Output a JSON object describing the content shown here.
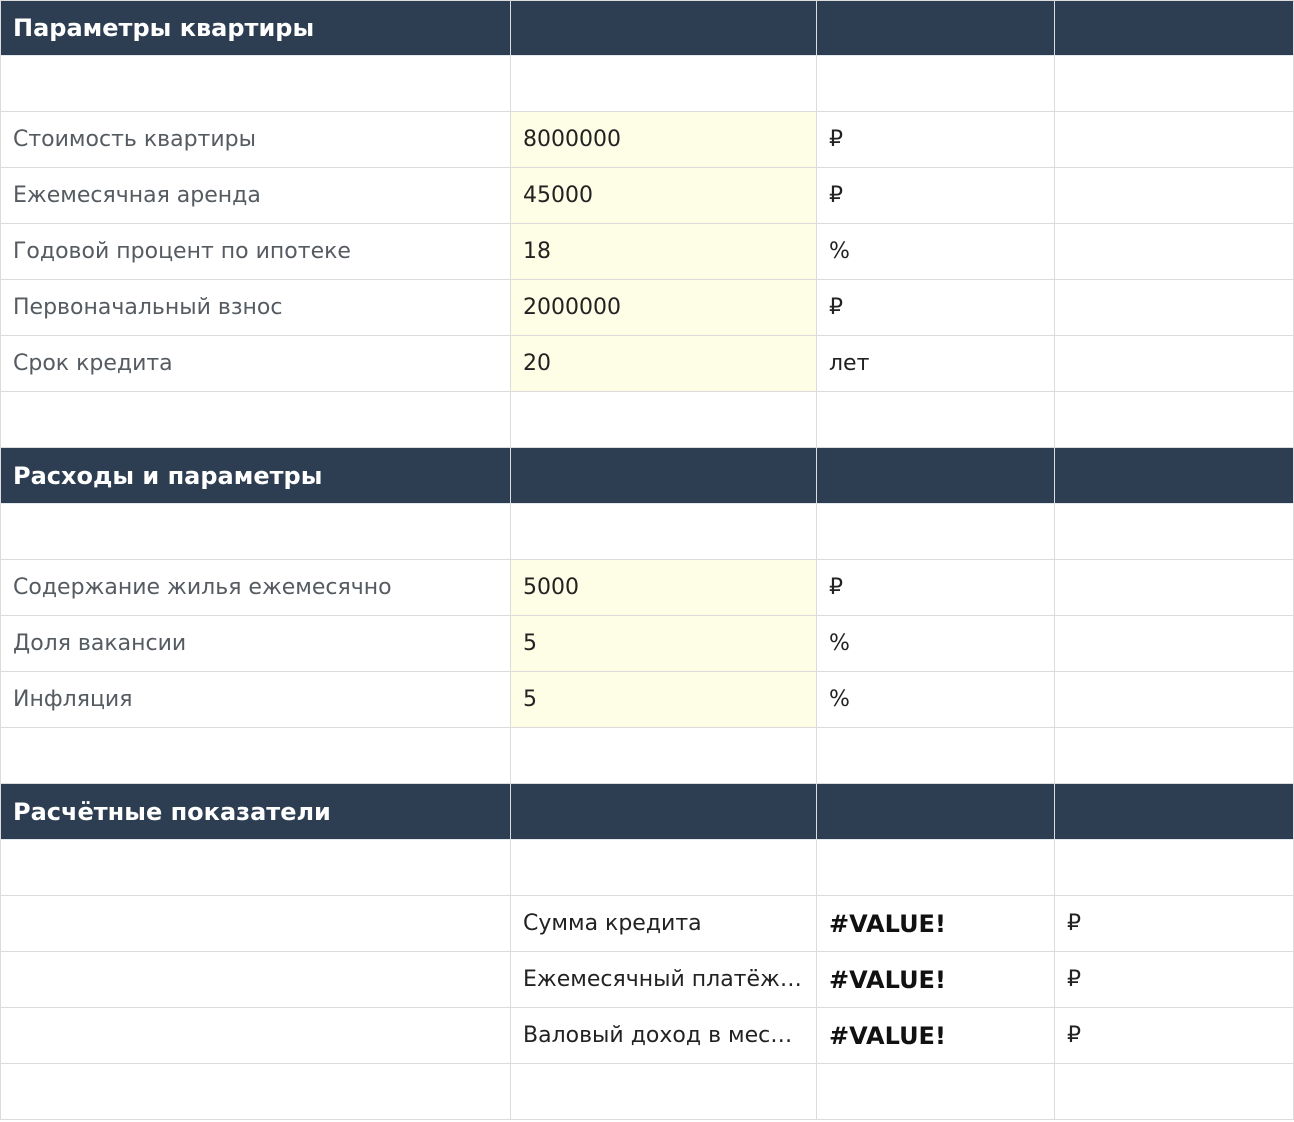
{
  "sections": {
    "apartment": {
      "title": "Параметры квартиры",
      "rows": [
        {
          "label": "Стоимость квартиры",
          "value": "8000000",
          "unit": "₽"
        },
        {
          "label": "Ежемесячная аренда",
          "value": "45000",
          "unit": "₽"
        },
        {
          "label": "Годовой процент по ипотеке",
          "value": "18",
          "unit": "%"
        },
        {
          "label": "Первоначальный взнос",
          "value": "2000000",
          "unit": "₽"
        },
        {
          "label": "Срок кредита",
          "value": "20",
          "unit": "лет"
        }
      ]
    },
    "expenses": {
      "title": "Расходы и параметры",
      "rows": [
        {
          "label": "Содержание жилья ежемесячно",
          "value": "5000",
          "unit": "₽"
        },
        {
          "label": "Доля вакансии",
          "value": "5",
          "unit": "%"
        },
        {
          "label": "Инфляция",
          "value": "5",
          "unit": "%"
        }
      ]
    },
    "calculated": {
      "title": "Расчётные показатели",
      "rows": [
        {
          "label": "Сумма кредита",
          "value": "#VALUE!",
          "unit": "₽"
        },
        {
          "label": "Ежемесячный платёж…",
          "value": "#VALUE!",
          "unit": "₽"
        },
        {
          "label": "Валовый доход в мес…",
          "value": "#VALUE!",
          "unit": "₽"
        }
      ]
    }
  },
  "colors": {
    "header_bg": "#2e3e52",
    "input_bg": "#fefee6",
    "grid": "#dcdcdc"
  }
}
